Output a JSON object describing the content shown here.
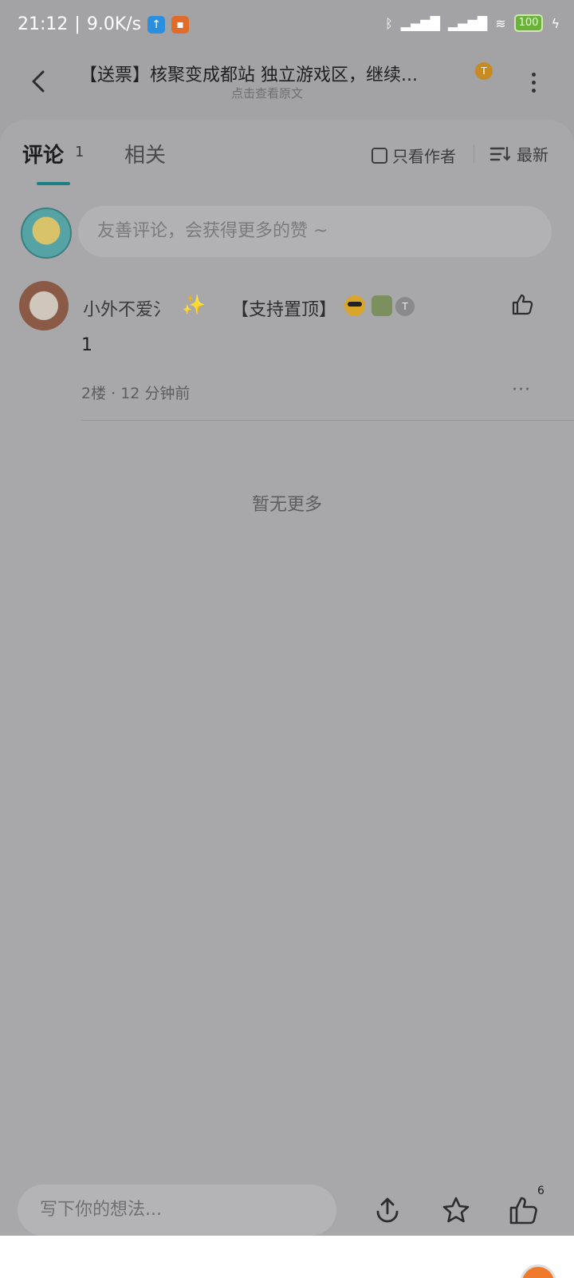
{
  "status_bar": {
    "time": "21:12",
    "net_speed": "9.0K/s",
    "battery": "100",
    "icons": [
      "upload-app-icon",
      "video-app-icon",
      "bluetooth-icon",
      "signal-hd-icon",
      "signal-hd-icon",
      "wifi-icon",
      "battery-icon",
      "charging-icon"
    ]
  },
  "header": {
    "title": "【送票】核聚变成都站 独立游戏区，继续...",
    "subtitle": "点击查看原文",
    "badge": "T"
  },
  "tabs": {
    "comments_label": "评论",
    "comments_count": "1",
    "related_label": "相关"
  },
  "filters": {
    "only_author": "只看作者",
    "sort_latest": "最新"
  },
  "comment_input": {
    "placeholder": "友善评论，会获得更多的赞 ~"
  },
  "comments": [
    {
      "username": "小外不爱氵",
      "sparkle": "✨",
      "tag": "【支持置顶】",
      "badge": "T",
      "body": "1",
      "meta": "2楼 · 12 分钟前",
      "more": "···"
    }
  ],
  "no_more_text": "暂无更多",
  "bottom_bar": {
    "write_placeholder": "写下你的想法...",
    "like_count": "6"
  },
  "colors": {
    "accent": "#1b7f86",
    "overlay_bg": "#a3a3a5",
    "coin_badge": "#c88a22"
  }
}
